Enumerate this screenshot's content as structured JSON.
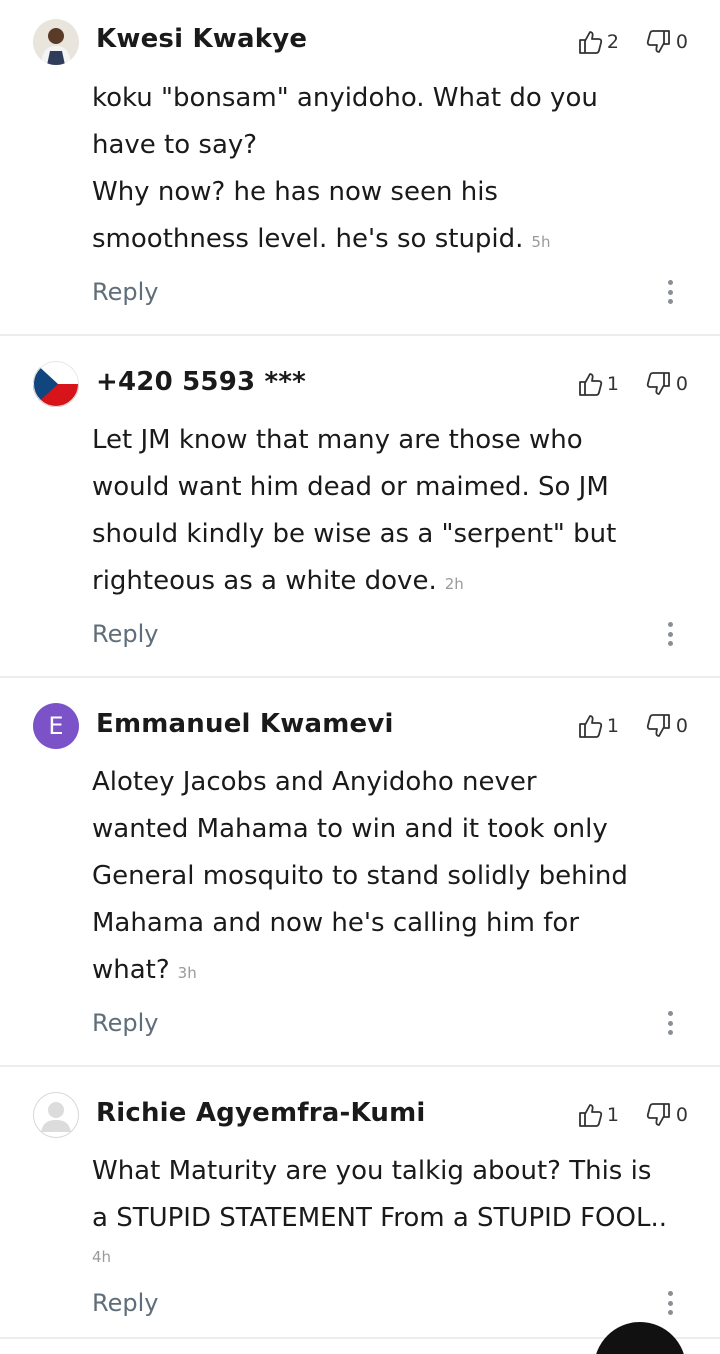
{
  "comments": [
    {
      "author": "Kwesi Kwakye",
      "avatar_icon": "user-photo-icon",
      "likes": "2",
      "dislikes": "0",
      "text": "koku \"bonsam\" anyidoho. What do you have to say?\nWhy now? he has now seen his smoothness level. he's so stupid.",
      "lines": [
        "koku \"bonsam\" anyidoho. What do you",
        "have to say?",
        "Why now? he has now seen his",
        "smoothness level. he's so stupid."
      ],
      "time": "5h",
      "reply_label": "Reply"
    },
    {
      "author": "+420 5593 ***",
      "avatar_icon": "czech-flag-icon",
      "likes": "1",
      "dislikes": "0",
      "lines": [
        "Let JM know that many are those who",
        "would want him dead or maimed. So JM",
        "should kindly be wise as a \"serpent\" but",
        "righteous as a white dove."
      ],
      "time": "2h",
      "reply_label": "Reply"
    },
    {
      "author": "Emmanuel Kwamevi",
      "avatar_letter": "E",
      "avatar_color": "#7b52c8",
      "likes": "1",
      "dislikes": "0",
      "lines": [
        "Alotey Jacobs and Anyidoho never",
        "wanted Mahama to win and it took only",
        "General mosquito to stand solidly behind",
        "Mahama and now he's calling him for",
        "what?"
      ],
      "time": "3h",
      "reply_label": "Reply"
    },
    {
      "author": "Richie Agyemfra-Kumi",
      "avatar_icon": "default-user-icon",
      "likes": "1",
      "dislikes": "0",
      "lines": [
        "What Maturity are you talkig about? This is",
        "a STUPID STATEMENT From a STUPID FOOL.."
      ],
      "time": "4h",
      "reply_label": "Reply"
    }
  ]
}
